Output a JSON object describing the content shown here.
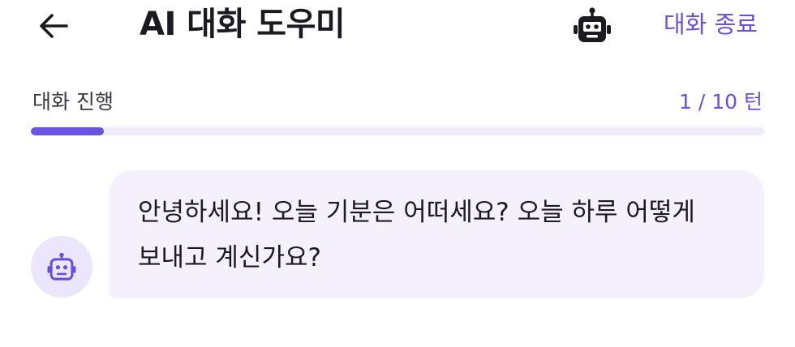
{
  "header": {
    "title": "AI 대화 도우미",
    "back_icon": "arrow-left-icon",
    "bot_icon": "robot-icon",
    "end_label": "대화 종료"
  },
  "progress": {
    "label": "대화 진행",
    "count_text": "1 / 10 턴",
    "current": 1,
    "total": 10
  },
  "messages": [
    {
      "sender": "bot",
      "avatar_icon": "robot-icon",
      "text": "안녕하세요! 오늘 기분은 어떠세요? 오늘 하루 어떻게 보내고 계신가요?"
    }
  ],
  "colors": {
    "accent": "#6750e0",
    "track": "#efebfb",
    "bubble": "#f4f1fd",
    "avatar_bg": "#ebe6fb"
  }
}
